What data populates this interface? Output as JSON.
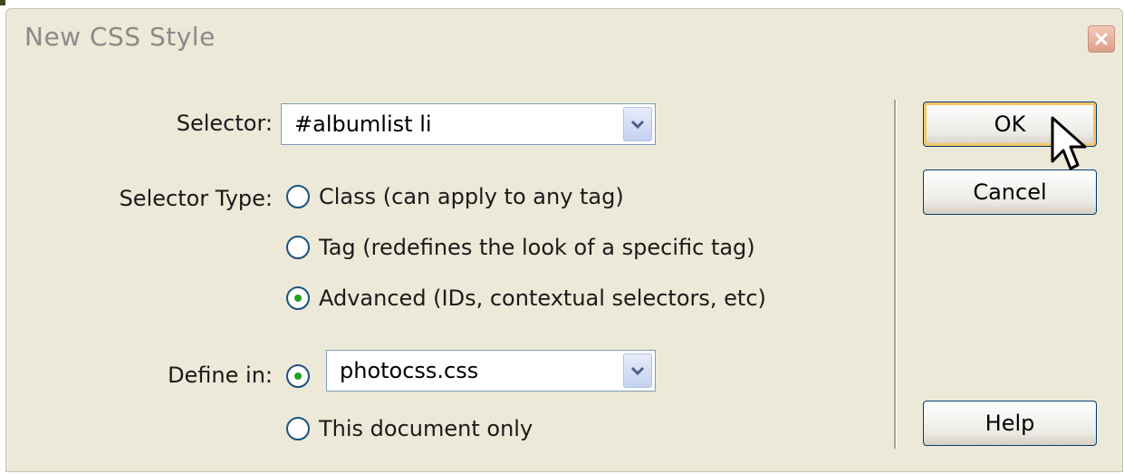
{
  "dialog": {
    "title": "New CSS Style",
    "close_icon": "close-icon"
  },
  "form": {
    "selector_label": "Selector:",
    "selector_value": "#albumlist li",
    "selector_type_label": "Selector Type:",
    "selector_types": [
      {
        "label": "Class (can apply to any tag)",
        "checked": false
      },
      {
        "label": "Tag (redefines the look of a specific tag)",
        "checked": false
      },
      {
        "label": "Advanced (IDs, contextual selectors, etc)",
        "checked": true
      }
    ],
    "define_in_label": "Define in:",
    "define_in_options": [
      {
        "label": "",
        "checked": true
      },
      {
        "label": "This document only",
        "checked": false
      }
    ],
    "define_in_file": "photocss.css"
  },
  "buttons": {
    "ok": "OK",
    "cancel": "Cancel",
    "help": "Help"
  },
  "colors": {
    "dialog_bg": "#ece9d8",
    "button_border": "#003c74",
    "default_highlight": "#f5c666",
    "radio_check": "#21a121"
  }
}
